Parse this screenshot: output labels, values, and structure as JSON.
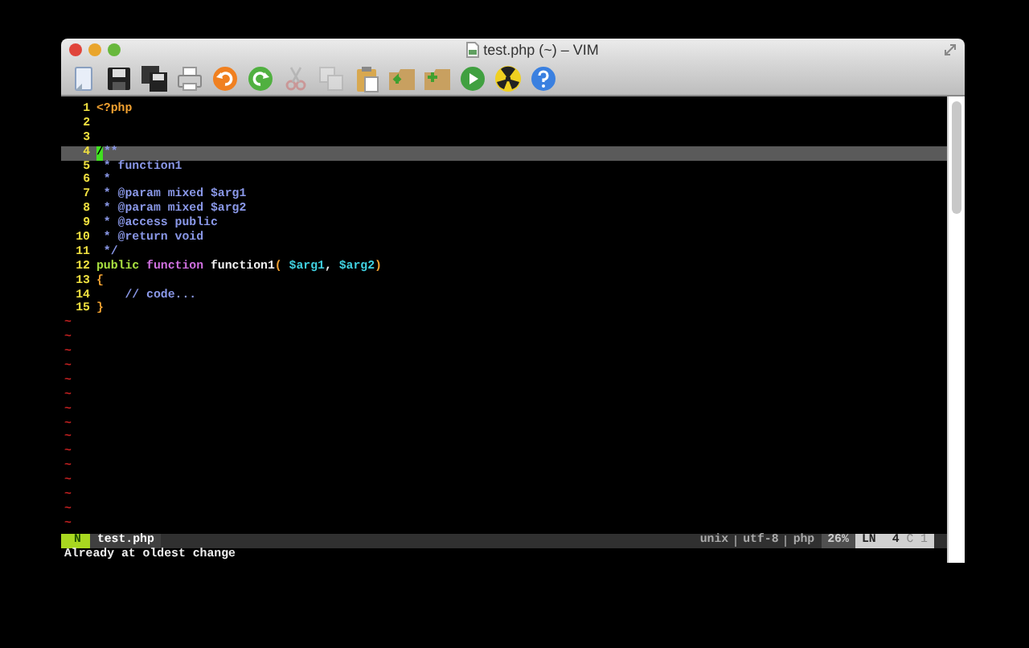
{
  "window": {
    "title": "test.php (~) – VIM"
  },
  "toolbar": [
    {
      "kind": "new",
      "disabled": false
    },
    {
      "kind": "save",
      "disabled": false
    },
    {
      "kind": "saveall",
      "disabled": false
    },
    {
      "kind": "print",
      "disabled": false
    },
    {
      "kind": "undo",
      "disabled": false
    },
    {
      "kind": "redo",
      "disabled": false
    },
    {
      "kind": "cut",
      "disabled": true
    },
    {
      "kind": "copy",
      "disabled": true
    },
    {
      "kind": "paste",
      "disabled": false
    },
    {
      "kind": "folderup",
      "disabled": false
    },
    {
      "kind": "folderadd",
      "disabled": false
    },
    {
      "kind": "run",
      "disabled": false
    },
    {
      "kind": "radiation",
      "disabled": false
    },
    {
      "kind": "help",
      "disabled": false
    }
  ],
  "lines": [
    {
      "number": "1",
      "current": false,
      "tokens": [
        {
          "kind": "preproc",
          "text": "<?php"
        }
      ]
    },
    {
      "number": "2",
      "current": false
    },
    {
      "number": "3",
      "current": false
    },
    {
      "number": "4",
      "current": true,
      "tokens": [
        {
          "kind": "cursor",
          "text": "/"
        },
        {
          "kind": "comment",
          "text": "**"
        }
      ]
    },
    {
      "number": "5",
      "current": false,
      "tokens": [
        {
          "kind": "comment",
          "text": " * function1"
        }
      ]
    },
    {
      "number": "6",
      "current": false,
      "tokens": [
        {
          "kind": "comment",
          "text": " *"
        }
      ]
    },
    {
      "number": "7",
      "current": false,
      "tokens": [
        {
          "kind": "comment",
          "text": " * @param mixed $arg1"
        }
      ]
    },
    {
      "number": "8",
      "current": false,
      "tokens": [
        {
          "kind": "comment",
          "text": " * @param mixed $arg2"
        }
      ]
    },
    {
      "number": "9",
      "current": false,
      "tokens": [
        {
          "kind": "comment",
          "text": " * @access public"
        }
      ]
    },
    {
      "number": "10",
      "current": false,
      "tokens": [
        {
          "kind": "comment",
          "text": " * @return void"
        }
      ]
    },
    {
      "number": "11",
      "current": false,
      "tokens": [
        {
          "kind": "comment",
          "text": " */"
        }
      ]
    },
    {
      "number": "12",
      "current": false,
      "tokens": [
        {
          "kind": "keyword",
          "text": "public"
        },
        {
          "kind": "function",
          "text": " function"
        },
        {
          "kind": "plain",
          "text": " function1"
        },
        {
          "kind": "brace",
          "text": "( "
        },
        {
          "kind": "variable",
          "text": "$arg1"
        },
        {
          "kind": "plain",
          "text": ", "
        },
        {
          "kind": "variable",
          "text": "$arg2"
        },
        {
          "kind": "brace",
          "text": ")"
        }
      ]
    },
    {
      "number": "13",
      "current": false,
      "tokens": [
        {
          "kind": "brace",
          "text": "{"
        }
      ]
    },
    {
      "number": "14",
      "current": false,
      "tokens": [
        {
          "kind": "comment",
          "text": "    // code..."
        }
      ]
    },
    {
      "number": "15",
      "current": false,
      "tokens": [
        {
          "kind": "brace",
          "text": "}"
        }
      ]
    }
  ],
  "filler": [
    "~",
    "~",
    "~",
    "~",
    "~",
    "~",
    "~",
    "~",
    "~",
    "~",
    "~",
    "~",
    "~",
    "~",
    "~"
  ],
  "status_line": {
    "mode": "N",
    "file": "test.php",
    "format": "unix",
    "encoding": "utf-8",
    "filetype": "php",
    "percent": "26%",
    "ln_label": "LN",
    "line": "4",
    "column": "C 1"
  },
  "message": "Already at oldest change"
}
